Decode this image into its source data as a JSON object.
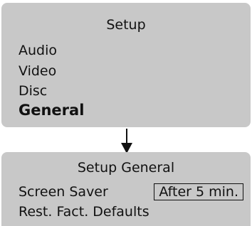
{
  "setup_menu": {
    "title": "Setup",
    "items": [
      {
        "label": "Audio"
      },
      {
        "label": "Video"
      },
      {
        "label": "Disc"
      },
      {
        "label": "General",
        "selected": true
      }
    ]
  },
  "arrow": {
    "icon": "arrow-down-icon"
  },
  "general_menu": {
    "title": "Setup General",
    "screen_saver": {
      "label": "Screen Saver",
      "value": "After 5 min."
    },
    "reset": {
      "label": "Rest. Fact. Defaults"
    }
  }
}
